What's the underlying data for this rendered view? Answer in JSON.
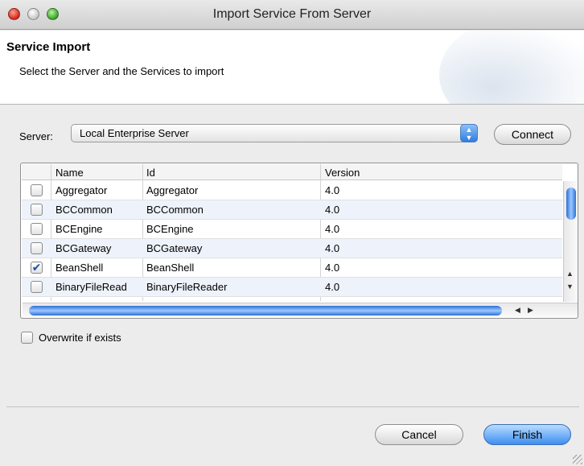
{
  "window": {
    "title": "Import Service From Server"
  },
  "banner": {
    "title": "Service Import",
    "description": "Select the Server and the Services to import"
  },
  "server": {
    "label": "Server:",
    "selected": "Local Enterprise Server",
    "connect_label": "Connect"
  },
  "table": {
    "columns": [
      "",
      "Name",
      "Id",
      "Version"
    ],
    "rows": [
      {
        "checked": false,
        "name": "Aggregator",
        "id": "Aggregator",
        "version": "4.0"
      },
      {
        "checked": false,
        "name": "BCCommon",
        "id": "BCCommon",
        "version": "4.0"
      },
      {
        "checked": false,
        "name": "BCEngine",
        "id": "BCEngine",
        "version": "4.0"
      },
      {
        "checked": false,
        "name": "BCGateway",
        "id": "BCGateway",
        "version": "4.0"
      },
      {
        "checked": true,
        "name": "BeanShell",
        "id": "BeanShell",
        "version": "4.0"
      },
      {
        "checked": false,
        "name": "BinaryFileRead",
        "id": "BinaryFileReader",
        "version": "4.0"
      }
    ]
  },
  "overwrite": {
    "label": "Overwrite if exists",
    "checked": false
  },
  "buttons": {
    "cancel": "Cancel",
    "finish": "Finish"
  },
  "icons": {
    "close": "close-icon",
    "minimize": "minimize-icon",
    "zoom": "zoom-icon",
    "combo_arrow": "chevron-updown-icon",
    "checkmark": "checkmark-icon"
  },
  "colors": {
    "accent": "#3d8ef0",
    "row_alt": "#eef3fb"
  }
}
